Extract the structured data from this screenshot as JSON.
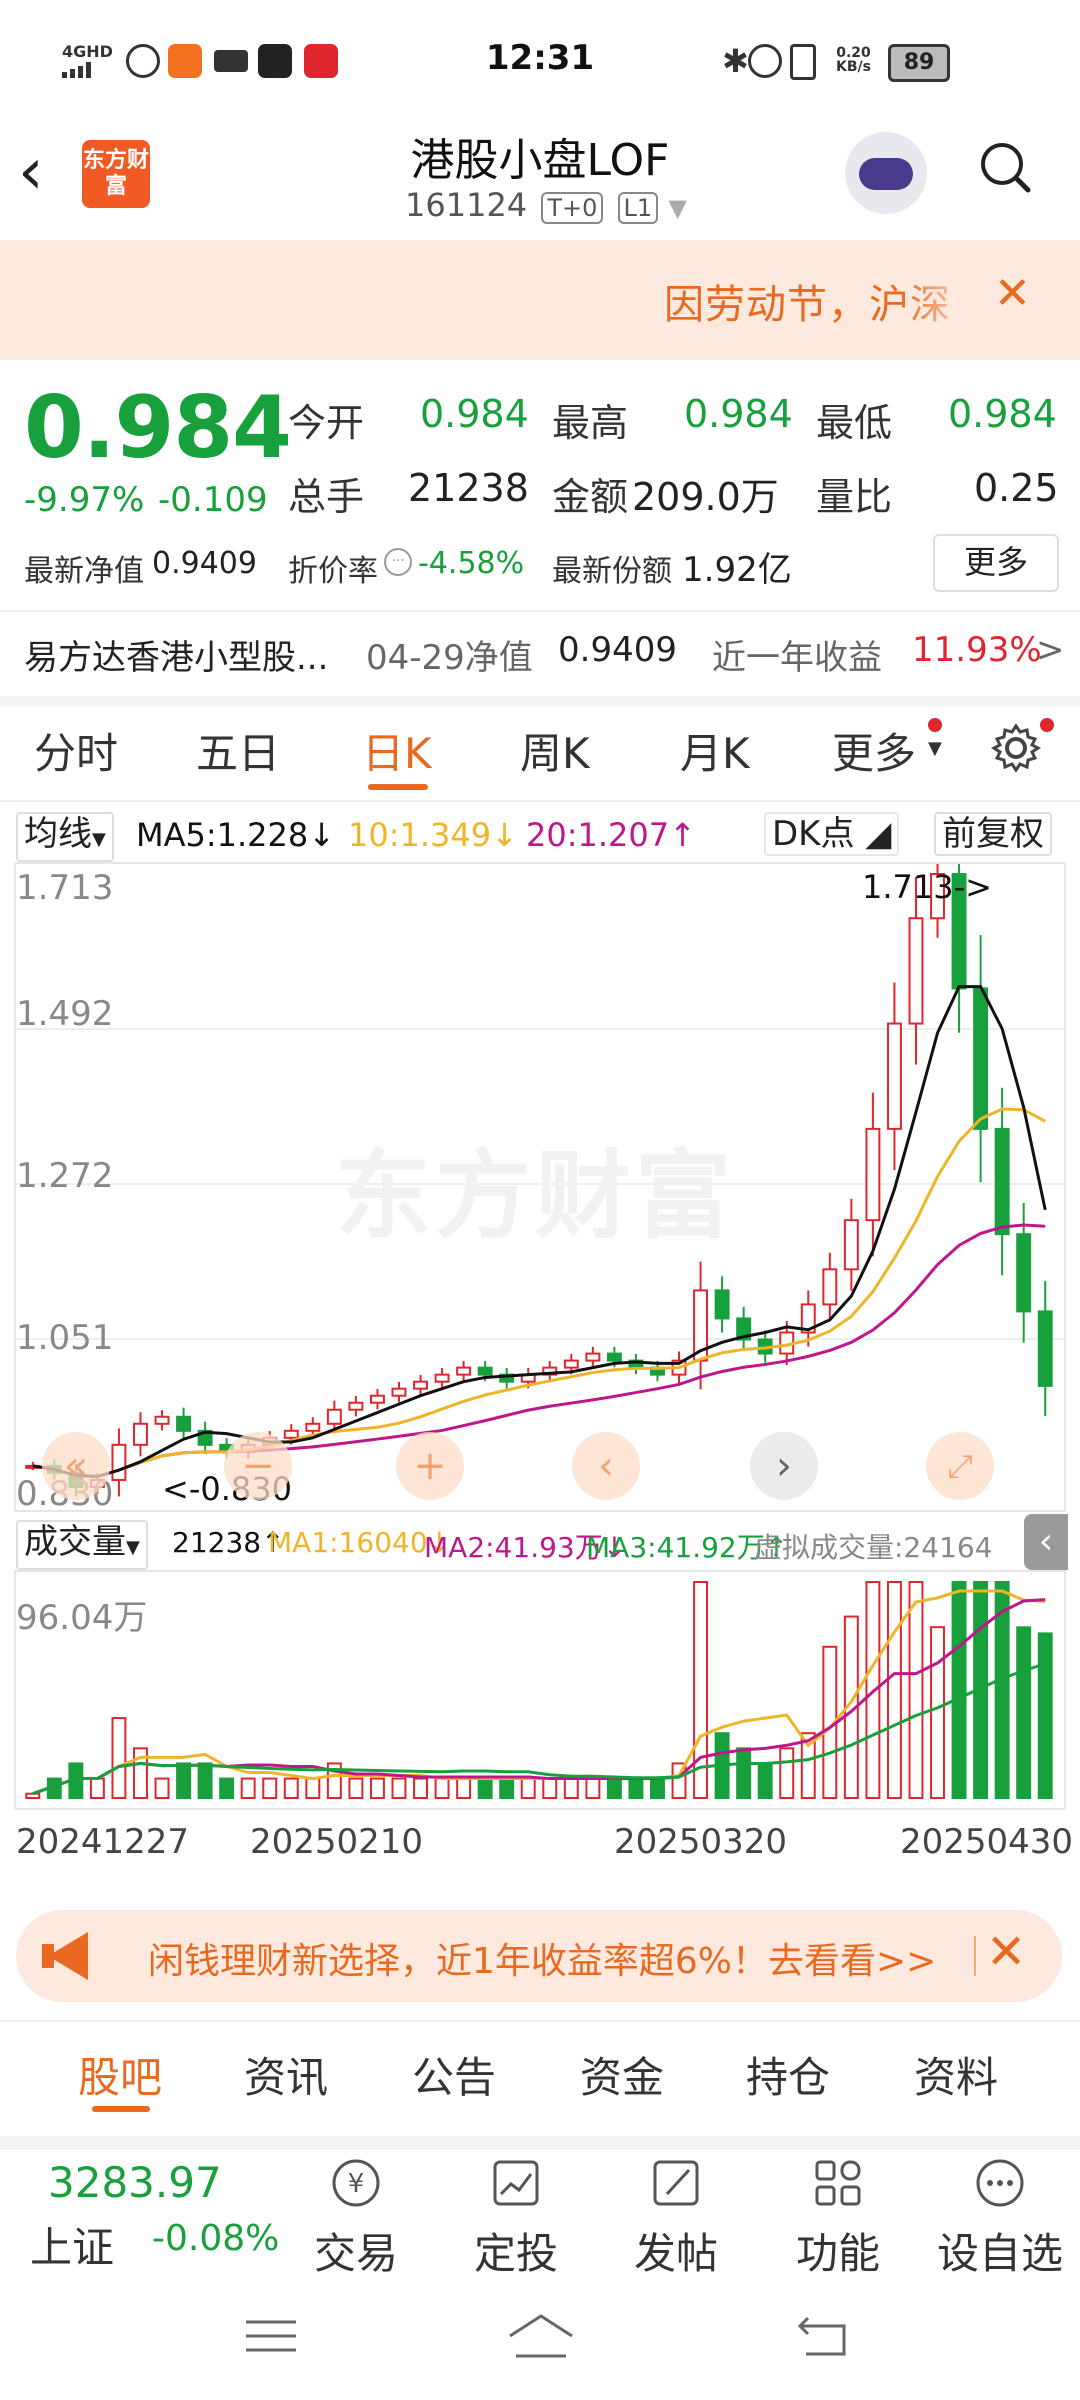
{
  "status_bar": {
    "time": "12:31",
    "net_label": "4GHD",
    "speed_value": "0.20",
    "speed_unit": "KB/s",
    "battery": "89"
  },
  "header": {
    "logo_text": "东方财富",
    "title": "港股小盘LOF",
    "code": "161124",
    "tag1": "T+0",
    "tag2": "L1"
  },
  "notice": {
    "text": "因劳动节，沪深"
  },
  "quote": {
    "price": "0.984",
    "change_pct": "-9.97%",
    "change": "-0.109",
    "open_label": "今开",
    "open": "0.984",
    "high_label": "最高",
    "high": "0.984",
    "low_label": "最低",
    "low": "0.984",
    "volume_label": "总手",
    "volume": "21238",
    "amount_label": "金额",
    "amount": "209.0万",
    "ratio_label": "量比",
    "ratio": "0.25",
    "nav_label": "最新净值",
    "nav": "0.9409",
    "discount_label": "折价率",
    "discount": "-4.58%",
    "shares_label": "最新份额",
    "shares": "1.92亿",
    "more": "更多"
  },
  "fund": {
    "name": "易方达香港小型股...",
    "nav_date_label": "04-29净值",
    "nav_value": "0.9409",
    "year_label": "近一年收益",
    "year_value": "11.93%",
    "arrow": ">"
  },
  "period_tabs": [
    "分时",
    "五日",
    "日K",
    "周K",
    "月K",
    "更多"
  ],
  "active_period": "日K",
  "ma": {
    "selector": "均线",
    "ma5": "MA5:1.228",
    "ma10": "10:1.349",
    "ma20": "20:1.207",
    "dk": "DK点",
    "adjust": "前复权"
  },
  "colors": {
    "up": "#e0262d",
    "down": "#17a03b",
    "ma5": "#111111",
    "ma10": "#f0b429",
    "ma20": "#c0168c",
    "accent": "#e8691f"
  },
  "chart_data": [
    {
      "type": "candlestick",
      "title": "",
      "y_ticks": [
        "1.713",
        "1.492",
        "1.272",
        "1.051",
        "0.830"
      ],
      "ylim": [
        0.83,
        1.713
      ],
      "annotations": {
        "max": "1.713->",
        "min": "<-0.830"
      },
      "x": [
        "20241227",
        "20250210",
        "20250320",
        "20250430"
      ],
      "close_trend_points": [
        0.87,
        0.86,
        0.84,
        0.85,
        0.9,
        0.93,
        0.94,
        0.92,
        0.9,
        0.89,
        0.9,
        0.91,
        0.92,
        0.93,
        0.95,
        0.96,
        0.97,
        0.98,
        0.99,
        1.0,
        1.01,
        1.0,
        0.99,
        1.0,
        1.01,
        1.02,
        1.03,
        1.02,
        1.01,
        1.0,
        1.02,
        1.12,
        1.08,
        1.05,
        1.03,
        1.06,
        1.1,
        1.15,
        1.22,
        1.35,
        1.5,
        1.65,
        1.713,
        1.55,
        1.35,
        1.2,
        1.09,
        0.984
      ]
    },
    {
      "type": "bar",
      "title": "",
      "y_ticks": [
        "96.04万"
      ],
      "volume_label": "成交量",
      "current": "21238",
      "ma1": "MA1:16040",
      "ma2": "MA2:41.93万",
      "ma3": "MA3:41.92万",
      "virtual": "虚拟成交量:24164",
      "x": [
        "20241227",
        "20250210",
        "20250320",
        "20250430"
      ]
    }
  ],
  "watermark": "东方财富",
  "promo": {
    "text": "闲钱理财新选择，近1年收益率超6%！去看看>>"
  },
  "bottom_tabs": [
    "股吧",
    "资讯",
    "公告",
    "资金",
    "持仓",
    "资料"
  ],
  "index": {
    "value": "3283.97",
    "name": "上证",
    "change": "-0.08%"
  },
  "bottom_bar": [
    "交易",
    "定投",
    "发帖",
    "功能",
    "设自选"
  ]
}
